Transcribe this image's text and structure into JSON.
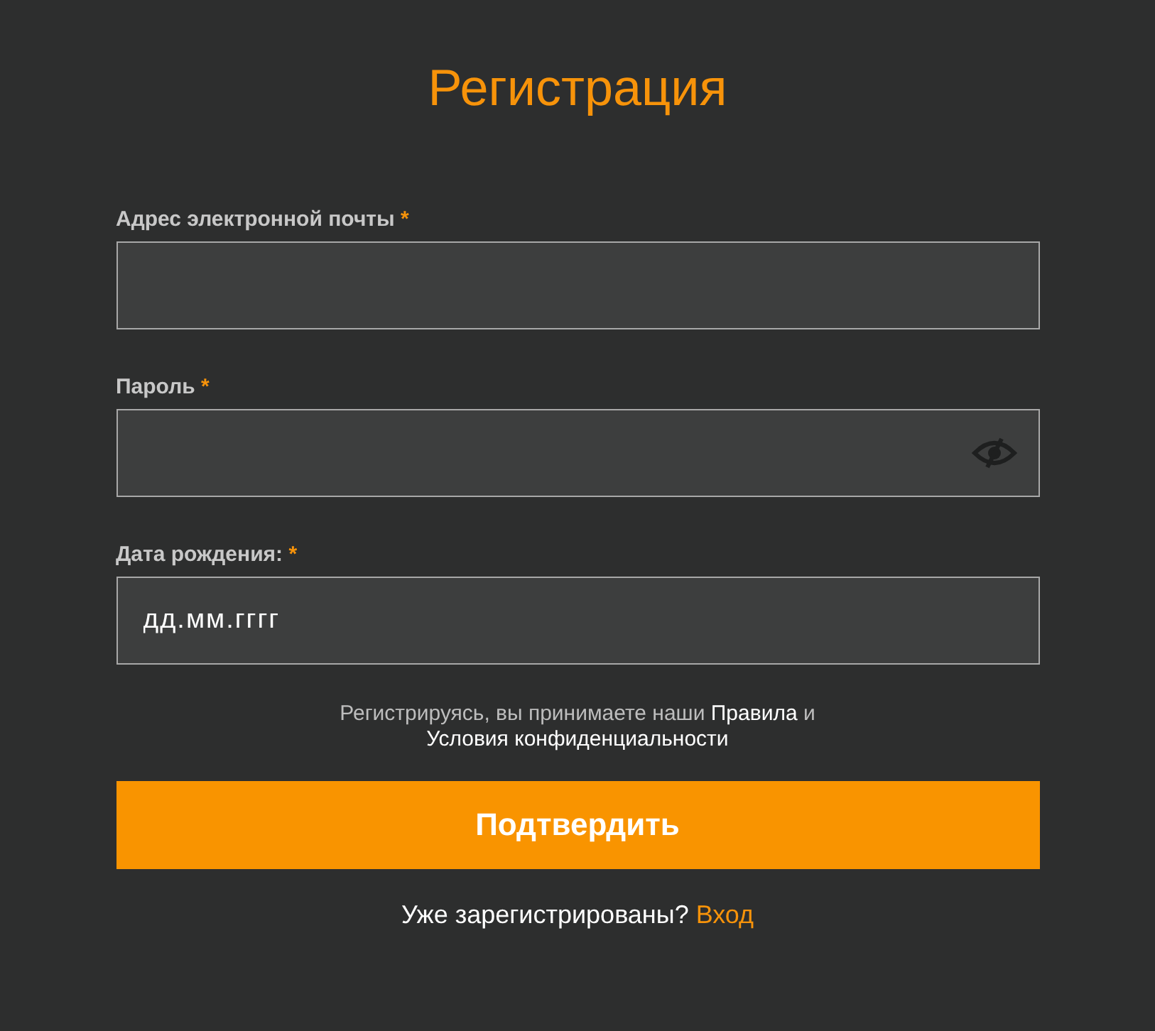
{
  "title": "Регистрация",
  "fields": [
    {
      "kind": "text",
      "label": "Адрес электронной почты",
      "required_mark": "*"
    },
    {
      "kind": "password",
      "label": "Пароль",
      "required_mark": "*"
    },
    {
      "kind": "date",
      "label": "Дата рождения:",
      "required_mark": "*",
      "placeholder": "дд.мм.гггг"
    }
  ],
  "terms": {
    "text": "Регистрируясь, вы принимаете наши",
    "link1": "Правила",
    "joiner": "и",
    "link2": "Условия конфиденциальности"
  },
  "submit": "Подтвердить",
  "login": {
    "text": "Уже зарегистрированы?",
    "link": "Вход"
  }
}
